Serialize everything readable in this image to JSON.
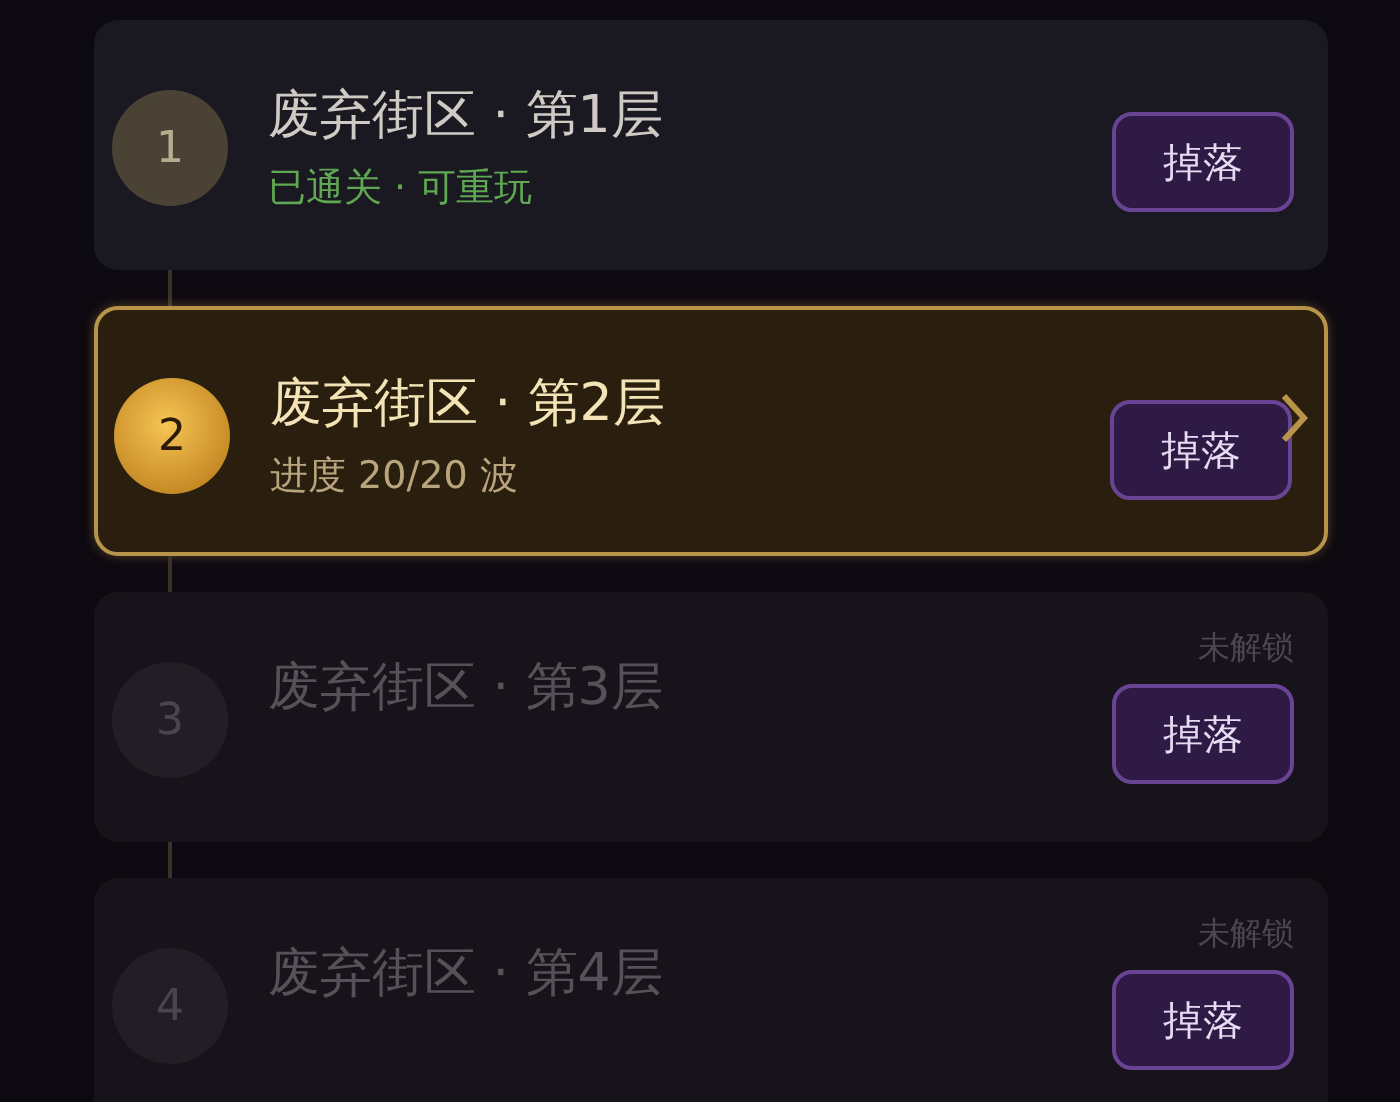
{
  "levels": [
    {
      "number": "1",
      "title": "废弃街区 · 第1层",
      "kind": "cleared",
      "selected": false,
      "subtitle": "已通关 · 可重玩",
      "button": "掉落"
    },
    {
      "number": "2",
      "title": "废弃街区 · 第2层",
      "kind": "current",
      "selected": true,
      "subtitle": "进度 20/20 波",
      "button": "掉落"
    },
    {
      "number": "3",
      "title": "废弃街区 · 第3层",
      "kind": "locked",
      "selected": false,
      "status": "未解锁",
      "button": "掉落"
    },
    {
      "number": "4",
      "title": "废弃街区 · 第4层",
      "kind": "locked",
      "selected": false,
      "status": "未解锁",
      "button": "掉落"
    }
  ]
}
